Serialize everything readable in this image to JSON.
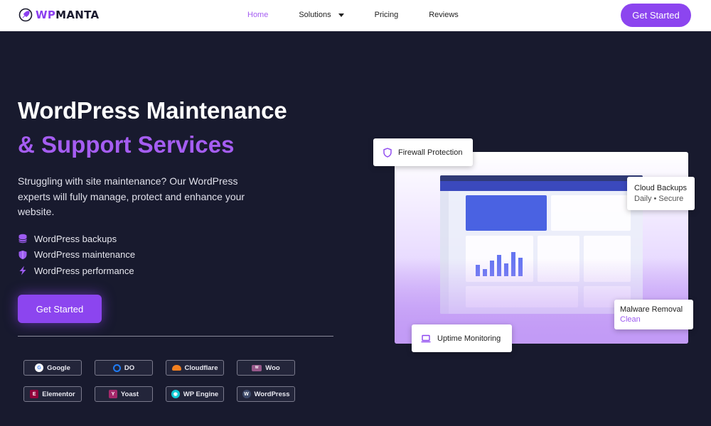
{
  "brand": {
    "logo_prefix": "WP",
    "logo_suffix": "MANTA",
    "accent": "#8c45ef",
    "accent_light": "#a55df2",
    "bg": "#181a2e"
  },
  "nav": {
    "items": [
      {
        "label": "Home",
        "active": true
      },
      {
        "label": "Solutions",
        "has_dropdown": true
      },
      {
        "label": "Pricing"
      },
      {
        "label": "Reviews"
      }
    ],
    "cta_label": "Get Started"
  },
  "hero": {
    "title_line1": "WordPress Maintenance",
    "title_line2": "& Support Services",
    "lede": "Struggling with site maintenance? Our WordPress experts will fully manage, protect and enhance your website.",
    "features": [
      {
        "icon": "database-icon",
        "label": "WordPress backups"
      },
      {
        "icon": "shield-icon",
        "label": "WordPress maintenance"
      },
      {
        "icon": "lightning-icon",
        "label": "WordPress performance"
      }
    ],
    "cta_label": "Get Started"
  },
  "partners": [
    {
      "label": "Google",
      "icon": "google-icon"
    },
    {
      "label": "DO",
      "icon": "digitalocean-icon"
    },
    {
      "label": "Cloudflare",
      "icon": "cloudflare-icon"
    },
    {
      "label": "Woo",
      "icon": "woo-icon"
    },
    {
      "label": "Elementor",
      "icon": "elementor-icon"
    },
    {
      "label": "Yoast",
      "icon": "yoast-icon"
    },
    {
      "label": "WP Engine",
      "icon": "wpengine-icon"
    },
    {
      "label": "WordPress",
      "icon": "wordpress-icon"
    }
  ],
  "floating": {
    "firewall": "Firewall Protection",
    "backups_title": "Cloud Backups",
    "backups_sub": "Daily • Secure",
    "malware_title": "Malware Removal",
    "malware_sub": "Clean",
    "uptime": "Uptime Monitoring"
  }
}
